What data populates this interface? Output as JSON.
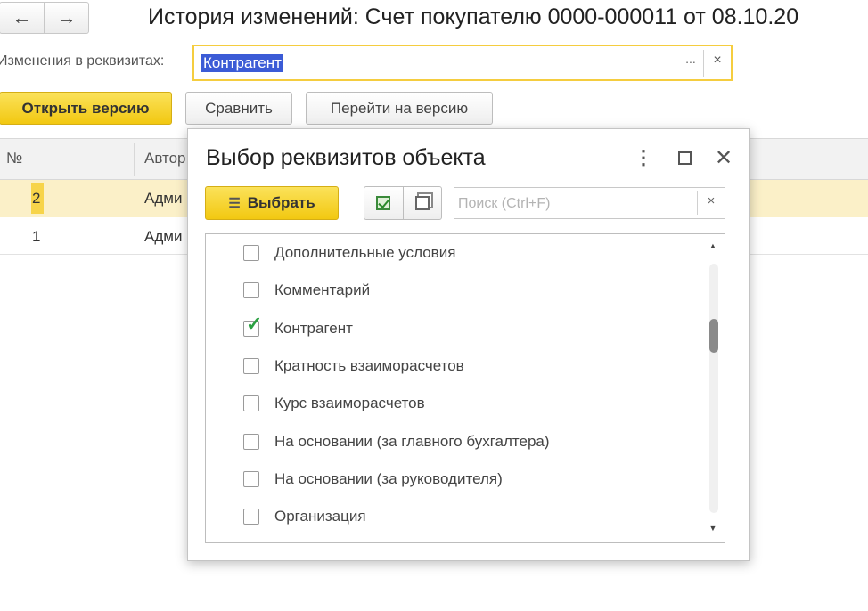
{
  "nav": {
    "back_glyph": "←",
    "forward_glyph": "→"
  },
  "window": {
    "title": "История изменений: Счет покупателю 0000-000011 от 08.10.20"
  },
  "filter": {
    "label": "Изменения в реквизитах:",
    "value": "Контрагент",
    "select_glyph": "...",
    "clear_glyph": "×"
  },
  "toolbar": {
    "open_version": "Открыть версию",
    "compare": "Сравнить",
    "goto_version": "Перейти на версию"
  },
  "table": {
    "columns": [
      "№",
      "Автор"
    ],
    "rows": [
      {
        "no": "2",
        "author": "Адми"
      },
      {
        "no": "1",
        "author": "Адми"
      }
    ]
  },
  "dialog": {
    "title": "Выбор реквизитов объекта",
    "more_glyph": "⋮",
    "close_glyph": "✕",
    "select_label": "Выбрать",
    "search_placeholder": "Поиск (Ctrl+F)",
    "search_clear": "×",
    "items": [
      {
        "label": "Дополнительные условия",
        "checked": false
      },
      {
        "label": "Комментарий",
        "checked": false
      },
      {
        "label": "Контрагент",
        "checked": true
      },
      {
        "label": "Кратность взаиморасчетов",
        "checked": false
      },
      {
        "label": "Курс взаиморасчетов",
        "checked": false
      },
      {
        "label": "На основании (за главного бухгалтера)",
        "checked": false
      },
      {
        "label": "На основании (за руководителя)",
        "checked": false
      },
      {
        "label": "Организация",
        "checked": false
      }
    ],
    "check_glyph": "✓",
    "scroll_up": "▲",
    "scroll_down": "▼"
  },
  "colors": {
    "accent_yellow": "#f5cd3f",
    "selection_blue": "#3b5bd6",
    "check_green": "#2aa041",
    "row_highlight": "#fbf0c8"
  }
}
